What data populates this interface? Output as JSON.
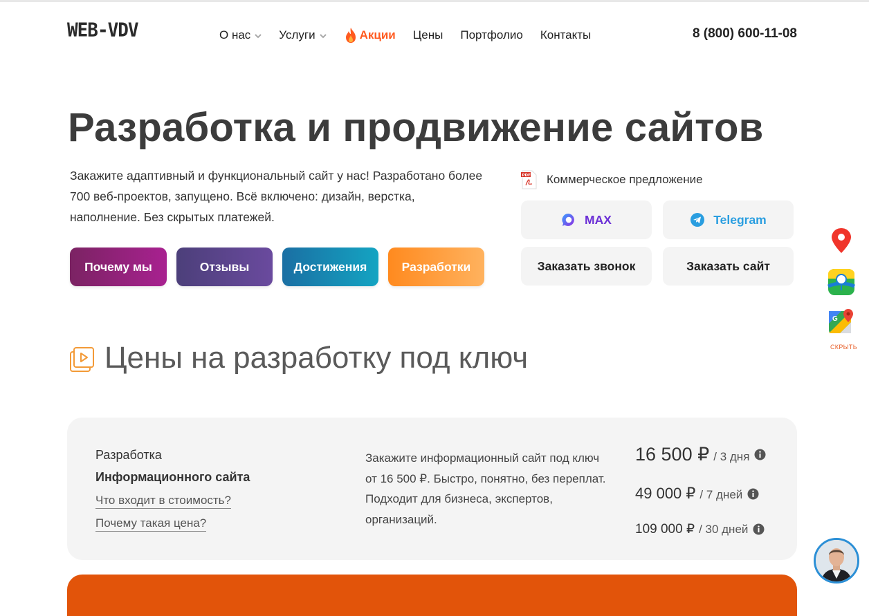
{
  "header": {
    "logo": "WEB-VDV",
    "nav": [
      {
        "label": "О нас",
        "has_dropdown": true
      },
      {
        "label": "Услуги",
        "has_dropdown": true
      },
      {
        "label": "Акции",
        "icon": "flame-icon"
      },
      {
        "label": "Цены"
      },
      {
        "label": "Портфолио"
      },
      {
        "label": "Контакты"
      }
    ],
    "phone": "8 (800) 600-11-08"
  },
  "hero": {
    "title": "Разработка и продвижение сайтов",
    "text": "Закажите адаптивный и функциональный сайт у нас! Разработано более 700 веб-проектов, запущено. Всё включено: дизайн, верстка, наполнение. Без скрытых платежей.",
    "buttons": [
      "Почему мы",
      "Отзывы",
      "Достижения",
      "Разработки"
    ]
  },
  "contact": {
    "offer_label": "Коммерческое предложение",
    "max_label": "MAX",
    "telegram_label": "Telegram",
    "call_label": "Заказать звонок",
    "order_label": "Заказать сайт"
  },
  "floating": {
    "hide_label": "СКРЫТЬ",
    "icons": [
      "map-pin-icon",
      "2gis-icon",
      "google-maps-icon"
    ]
  },
  "section": {
    "title": "Цены на разработку под ключ"
  },
  "price_card": {
    "category": "Разработка",
    "name": "Информационного сайта",
    "link1": "Что входит в стоимость?",
    "link2": "Почему такая цена?",
    "description": "Закажите информационный сайт под ключ от 16 500 ₽. Быстро, понятно, без переплат. Подходит для бизнеса, экспертов, организаций.",
    "prices": [
      {
        "amount": "16 500 ₽",
        "period": "/ 3 дня"
      },
      {
        "amount": "49 000 ₽",
        "period": "/ 7 дней"
      },
      {
        "amount": "109 000 ₽",
        "period": "/ 30 дней"
      }
    ]
  },
  "colors": {
    "accent_orange": "#ff5a1f",
    "max_purple": "#6b2fd6",
    "telegram_blue": "#2a9ee0",
    "card_bg": "#f4f4f4",
    "bottom_card": "#e2540a"
  }
}
